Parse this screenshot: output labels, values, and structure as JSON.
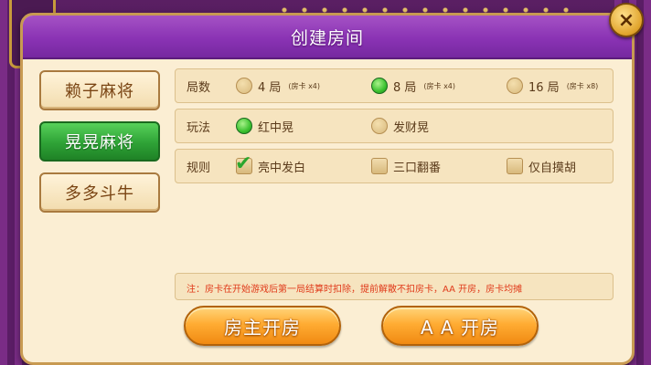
{
  "dialog": {
    "title": "创建房间",
    "close_label": "×"
  },
  "game_types": [
    {
      "label": "赖子麻将",
      "selected": false
    },
    {
      "label": "晃晃麻将",
      "selected": true
    },
    {
      "label": "多多斗牛",
      "selected": false
    }
  ],
  "rounds": {
    "label": "局数",
    "options": [
      {
        "label": "4 局",
        "note": "(房卡 x4)",
        "selected": false
      },
      {
        "label": "8 局",
        "note": "(房卡 x4)",
        "selected": true
      },
      {
        "label": "16 局",
        "note": "(房卡 x8)",
        "selected": false
      }
    ]
  },
  "play_mode": {
    "label": "玩法",
    "options": [
      {
        "label": "红中晃",
        "selected": true
      },
      {
        "label": "发财晃",
        "selected": false
      }
    ]
  },
  "rules": {
    "label": "规则",
    "options": [
      {
        "label": "亮中发白",
        "checked": true
      },
      {
        "label": "三口翻番",
        "checked": false
      },
      {
        "label": "仅自摸胡",
        "checked": false
      }
    ]
  },
  "notice": "注：房卡在开始游戏后第一局结算时扣除，提前解散不扣房卡，AA 开房，房卡均摊",
  "actions": {
    "host_open": "房主开房",
    "aa_open": "A A  开房"
  },
  "colors": {
    "title_bar": "#8a33b4",
    "panel": "#fbeed3",
    "selected_green": "#2ea236",
    "action_orange": "#ffac33",
    "notice_red": "#e03a1a"
  }
}
